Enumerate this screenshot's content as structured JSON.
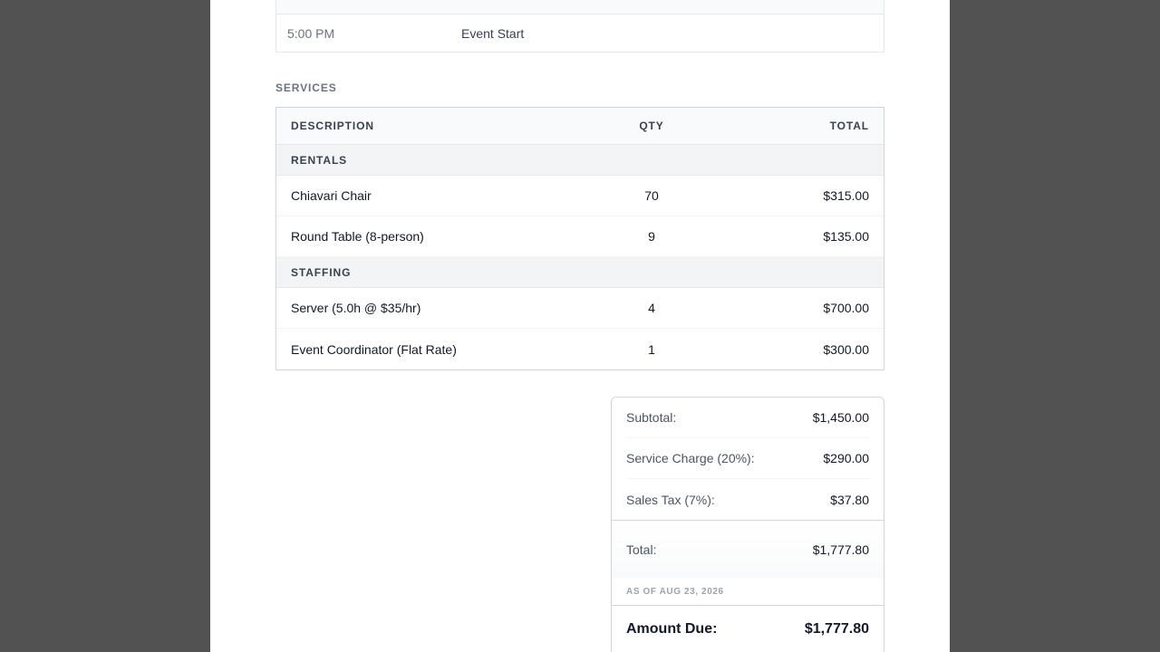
{
  "timeline": {
    "rows": [
      {
        "time": "",
        "label": ""
      },
      {
        "time": "5:00 PM",
        "label": "Event Start"
      }
    ]
  },
  "services": {
    "section_title": "SERVICES",
    "headers": {
      "description": "DESCRIPTION",
      "qty": "QTY",
      "total": "TOTAL"
    },
    "groups": [
      {
        "name": "RENTALS",
        "items": [
          {
            "description": "Chiavari Chair",
            "qty": "70",
            "total": "$315.00"
          },
          {
            "description": "Round Table (8-person)",
            "qty": "9",
            "total": "$135.00"
          }
        ]
      },
      {
        "name": "STAFFING",
        "items": [
          {
            "description": "Server (5.0h @ $35/hr)",
            "qty": "4",
            "total": "$700.00"
          },
          {
            "description": "Event Coordinator (Flat Rate)",
            "qty": "1",
            "total": "$300.00"
          }
        ]
      }
    ]
  },
  "summary": {
    "subtotal_label": "Subtotal:",
    "subtotal_value": "$1,450.00",
    "service_charge_label": "Service Charge (20%):",
    "service_charge_value": "$290.00",
    "sales_tax_label": "Sales Tax (7%):",
    "sales_tax_value": "$37.80",
    "total_label": "Total:",
    "total_value": "$1,777.80",
    "as_of": "AS OF AUG 23, 2026",
    "amount_due_label": "Amount Due:",
    "amount_due_value": "$1,777.80"
  }
}
